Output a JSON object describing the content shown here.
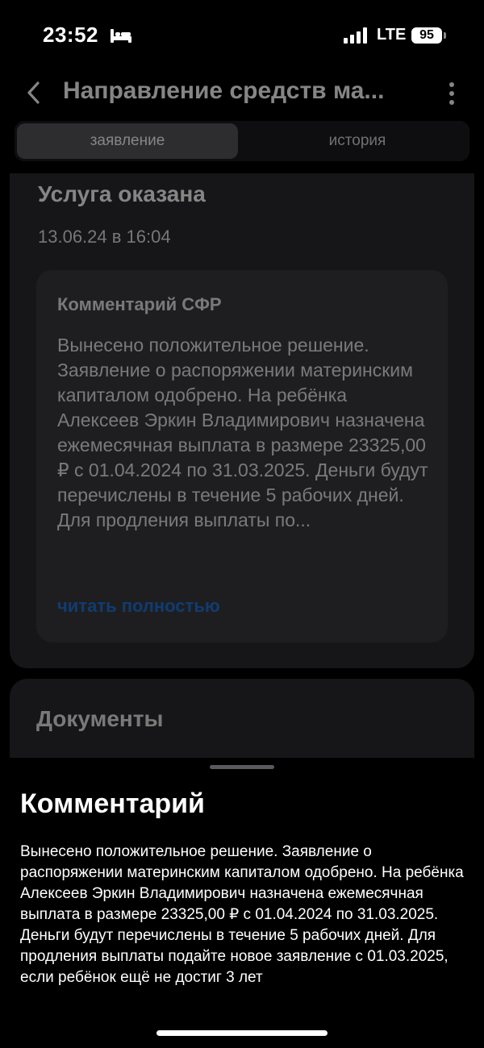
{
  "status_bar": {
    "time": "23:52",
    "network": "LTE",
    "battery": "95",
    "icons": [
      "bed-icon",
      "signal-icon"
    ]
  },
  "header": {
    "title": "Направление средств ма...",
    "icons": [
      "chevron-left-icon",
      "more-vertical-icon"
    ]
  },
  "tabs": [
    {
      "label": "заявление",
      "active": true
    },
    {
      "label": "история",
      "active": false
    }
  ],
  "status_card": {
    "title": "Услуга оказана",
    "date": "13.06.24 в 16:04",
    "comment_box": {
      "heading": "Комментарий СФР",
      "preview": "Вынесено положительное решение. Заявление о распоряжении материнским капиталом одобрено. На ребёнка Алексеев Эркин Владимирович назначена ежемесячная выплата в размере 23325,00 ₽ с 01.04.2024 по 31.03.2025. Деньги будут перечислены в течение 5 рабочих дней. Для продления выплаты по...",
      "read_more": "читать полностью"
    }
  },
  "documents_card": {
    "title": "Документы"
  },
  "sheet": {
    "title": "Комментарий",
    "body": "Вынесено положительное решение. Заявление о распоряжении материнским капиталом одобрено. На ребёнка Алексеев Эркин Владимирович назначена ежемесячная выплата в размере 23325,00 ₽ с 01.04.2024 по 31.03.2025. Деньги будут перечислены в течение 5 рабочих дней. Для продления выплаты подайте новое заявление с 01.03.2025, если ребёнок ещё не достиг 3 лет"
  },
  "colors": {
    "accent_link": "#1f73d8",
    "card_background": "#2a2a2e",
    "comment_box_background": "#3a3a3f",
    "active_tab_background": "#57575c"
  }
}
